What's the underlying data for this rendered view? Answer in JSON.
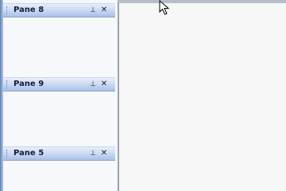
{
  "panes": [
    {
      "title": "Pane 8",
      "pin_icon": "pin-icon",
      "close_icon": "close-icon"
    },
    {
      "title": "Pane 9",
      "pin_icon": "pin-icon",
      "close_icon": "close-icon"
    },
    {
      "title": "Pane 5",
      "pin_icon": "pin-icon",
      "close_icon": "close-icon"
    }
  ],
  "glyphs": {
    "pin": "⊥",
    "close": "✕"
  },
  "colors": {
    "pane_header": "#c8d7f2",
    "left_edge": "#5e7fb3",
    "content_bg": "#f7f7f7"
  }
}
